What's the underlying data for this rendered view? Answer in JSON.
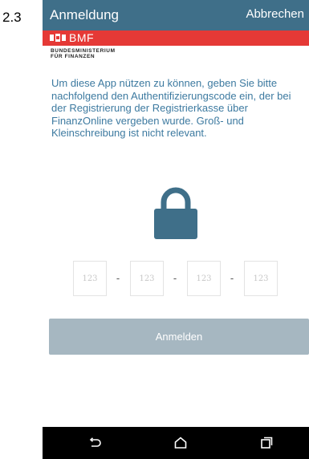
{
  "step": {
    "label": "2.3"
  },
  "app_bar": {
    "title": "Anmeldung",
    "cancel_label": "Abbrechen"
  },
  "brand": {
    "logo_text": "BMF",
    "ministry_line1": "BUNDESMINISTERIUM",
    "ministry_line2": "FÜR FINANZEN"
  },
  "intro": {
    "text": "Um diese App nützen zu können, geben Sie bitte nachfolgend den Authentifizierungscode ein, der bei der Registrierung der Registrierkasse über FinanzOnline vergeben wurde. Groß- und Kleinschreibung ist nicht relevant."
  },
  "code": {
    "fields": [
      {
        "placeholder": "123"
      },
      {
        "placeholder": "123"
      },
      {
        "placeholder": "123"
      },
      {
        "placeholder": "123"
      }
    ],
    "separator": "-"
  },
  "login": {
    "label": "Anmelden"
  },
  "colors": {
    "app_bar": "#3f6f89",
    "brand_red": "#e53936",
    "intro_text": "#3d7aa0",
    "button_disabled": "#a6b7c1",
    "lock": "#3f6f89"
  },
  "nav": {
    "icons": [
      "back-icon",
      "home-icon",
      "recents-icon"
    ]
  }
}
